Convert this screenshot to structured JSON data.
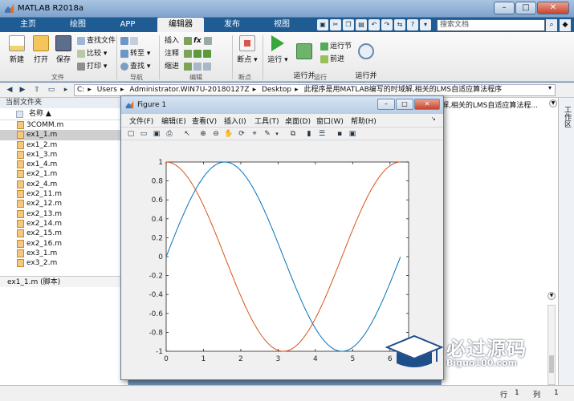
{
  "window": {
    "title": "MATLAB R2018a"
  },
  "tabs": [
    {
      "label": "主页",
      "active": false
    },
    {
      "label": "绘图",
      "active": false
    },
    {
      "label": "APP",
      "active": false
    },
    {
      "label": "编辑器",
      "active": true
    },
    {
      "label": "发布",
      "active": false
    },
    {
      "label": "视图",
      "active": false
    }
  ],
  "search": {
    "placeholder": "搜索文档"
  },
  "ribbon": {
    "new_label": "新建",
    "open_label": "打开",
    "save_label": "保存",
    "find_files_label": "查找文件",
    "compare_label": "比较",
    "print_label": "打印",
    "file_group": "文件",
    "goto_label": "转至",
    "find_label": "查找",
    "nav_group": "导航",
    "insert_label": "插入",
    "comment_label": "注释",
    "indent_label": "缩进",
    "fx_label": "fx",
    "edit_group": "编辑",
    "breakpoint_label": "断点",
    "breakpoint_group": "断点",
    "run_label": "运行",
    "run_advance_label": "运行并\n前进",
    "run_section_label": "运行节",
    "advance_label": "前进",
    "run_time_label": "运行并\n计时",
    "run_group": "运行"
  },
  "address": {
    "segments": [
      "C:",
      "Users",
      "Administrator.WIN7U-20180127Z",
      "Desktop",
      "此程序是用MATLAB编写的时域解,相关的LMS自适应算法程序"
    ]
  },
  "current_folder": {
    "header": "当前文件夹",
    "name_col": "名称 ▲",
    "files": [
      "3COMM.m",
      "ex1_1.m",
      "ex1_2.m",
      "ex1_3.m",
      "ex1_4.m",
      "ex2_1.m",
      "ex2_4.m",
      "ex2_11.m",
      "ex2_12.m",
      "ex2_13.m",
      "ex2_14.m",
      "ex2_15.m",
      "ex2_16.m",
      "ex3_1.m",
      "ex3_2.m"
    ],
    "selected_index": 1,
    "detail": "ex1_1.m  (脚本)"
  },
  "workspace": {
    "path_text": "解,相关的LMS自适应算法程...",
    "vtab_label": "工作区"
  },
  "statusbar": {
    "line_label": "行",
    "line_value": "1",
    "col_label": "列",
    "col_value": "1"
  },
  "figure": {
    "title": "Figure 1",
    "menu": [
      "文件(F)",
      "编辑(E)",
      "查看(V)",
      "插入(I)",
      "工具(T)",
      "桌面(D)",
      "窗口(W)",
      "帮助(H)"
    ]
  },
  "chart_data": {
    "type": "line",
    "xlim": [
      0,
      6.5
    ],
    "ylim": [
      -1,
      1
    ],
    "xticks": [
      0,
      1,
      2,
      3,
      4,
      5,
      6
    ],
    "yticks": [
      -1,
      -0.8,
      -0.6,
      -0.4,
      -0.2,
      0,
      0.2,
      0.4,
      0.6,
      0.8,
      1
    ],
    "series": [
      {
        "function": "sin(x)",
        "x_range": [
          0,
          6.28
        ],
        "color": "#0072bd"
      },
      {
        "function": "cos(x)",
        "x_range": [
          0,
          6.28
        ],
        "color": "#d95319"
      }
    ],
    "grid": false
  },
  "watermark": {
    "main": "必过源码",
    "sub": "Biguo100.com"
  },
  "colors": {
    "tab_bar": "#1f5c94",
    "accent": "#0072bd",
    "series2": "#d95319"
  }
}
